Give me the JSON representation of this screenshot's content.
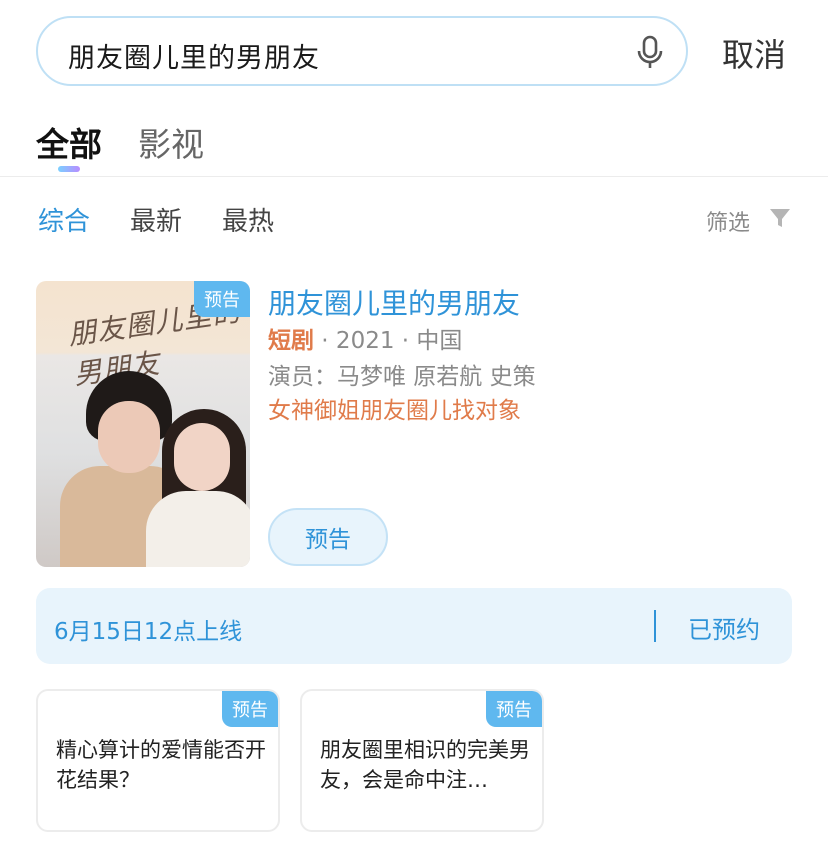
{
  "search": {
    "query": "朋友圈儿里的男朋友",
    "cancel_label": "取消",
    "mic_icon": "microphone-icon"
  },
  "tabs": [
    {
      "label": "全部",
      "active": true
    },
    {
      "label": "影视",
      "active": false
    }
  ],
  "sort_options": [
    {
      "label": "综合",
      "active": true
    },
    {
      "label": "最新",
      "active": false
    },
    {
      "label": "最热",
      "active": false
    }
  ],
  "filter": {
    "label": "筛选",
    "icon": "funnel-icon"
  },
  "result": {
    "badge": "预告",
    "poster_title": "朋友圈儿里的男朋友",
    "title": "朋友圈儿里的男朋友",
    "genre": "短剧",
    "year_region": " · 2021 · 中国",
    "cast": "演员：马梦唯 原若航 史策",
    "tagline": "女神御姐朋友圈儿找对象",
    "trailer_label": "预告"
  },
  "release": {
    "date_text": "6月15日12点上线",
    "reserved_label": "已预约"
  },
  "related": [
    {
      "badge": "预告",
      "text": "精心算计的爱情能否开花结果？"
    },
    {
      "badge": "预告",
      "text": "朋友圈里相识的完美男友，会是命中注…"
    }
  ],
  "colors": {
    "accent": "#2f93d8",
    "badge": "#5fb8ef",
    "highlight": "#e07b4a",
    "light_bg": "#e8f4fc"
  }
}
